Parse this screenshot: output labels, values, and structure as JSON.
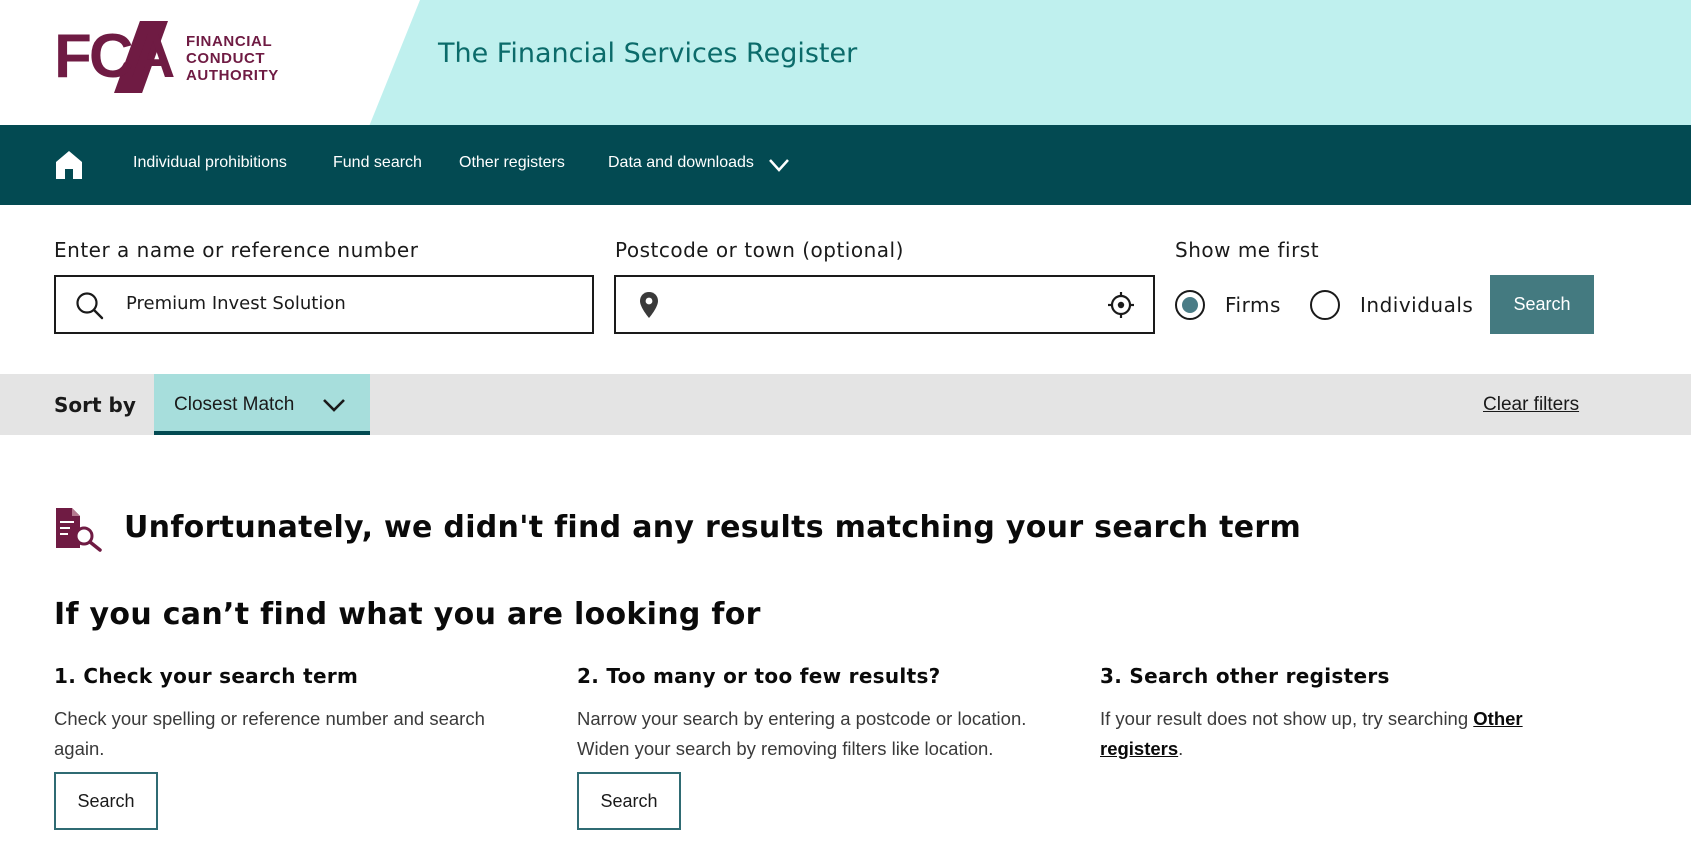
{
  "header": {
    "logo_letters": "FCA",
    "logo_lines": [
      "FINANCIAL",
      "CONDUCT",
      "AUTHORITY"
    ],
    "title": "The Financial Services Register"
  },
  "nav": {
    "items": [
      {
        "label": "Individual prohibitions"
      },
      {
        "label": "Fund search"
      },
      {
        "label": "Other registers"
      },
      {
        "label": "Data and downloads"
      }
    ]
  },
  "search": {
    "name_label": "Enter a name or reference number",
    "name_value": "Premium Invest Solution",
    "location_label": "Postcode or town (optional)",
    "location_value": "",
    "show_me_first_label": "Show me first",
    "option_firms": "Firms",
    "option_individuals": "Individuals",
    "selected_option": "Firms",
    "search_button": "Search"
  },
  "sort": {
    "label": "Sort by",
    "selected": "Closest Match",
    "clear_filters": "Clear filters"
  },
  "results": {
    "no_results_title": "Unfortunately, we didn't find any results matching your search term",
    "help_title": "If you can’t find what you are looking for",
    "tips": [
      {
        "title": "1. Check your search term",
        "text": "Check your spelling or reference number and search again.",
        "button": "Search"
      },
      {
        "title": "2. Too many or too few results?",
        "text": "Narrow your search by entering a postcode or location. Widen your search by removing filters like location.",
        "button": "Search"
      },
      {
        "title": "3. Search other registers",
        "text_before": "If your result does not show up, try searching ",
        "link": "Other registers",
        "text_after": "."
      }
    ]
  },
  "colors": {
    "brand_purple": "#6f1b43",
    "nav_teal": "#034a52",
    "header_mint": "#bff0ee",
    "title_teal": "#0b6b6a",
    "button_teal": "#447a80",
    "sort_mint": "#a7dedc"
  },
  "icons": {
    "home": "home-icon",
    "nav_chevron": "chevron-down-icon",
    "search": "search-icon",
    "location": "map-pin-icon",
    "gps": "crosshair-icon",
    "sort_chevron": "chevron-down-icon",
    "no_results": "document-search-icon"
  }
}
